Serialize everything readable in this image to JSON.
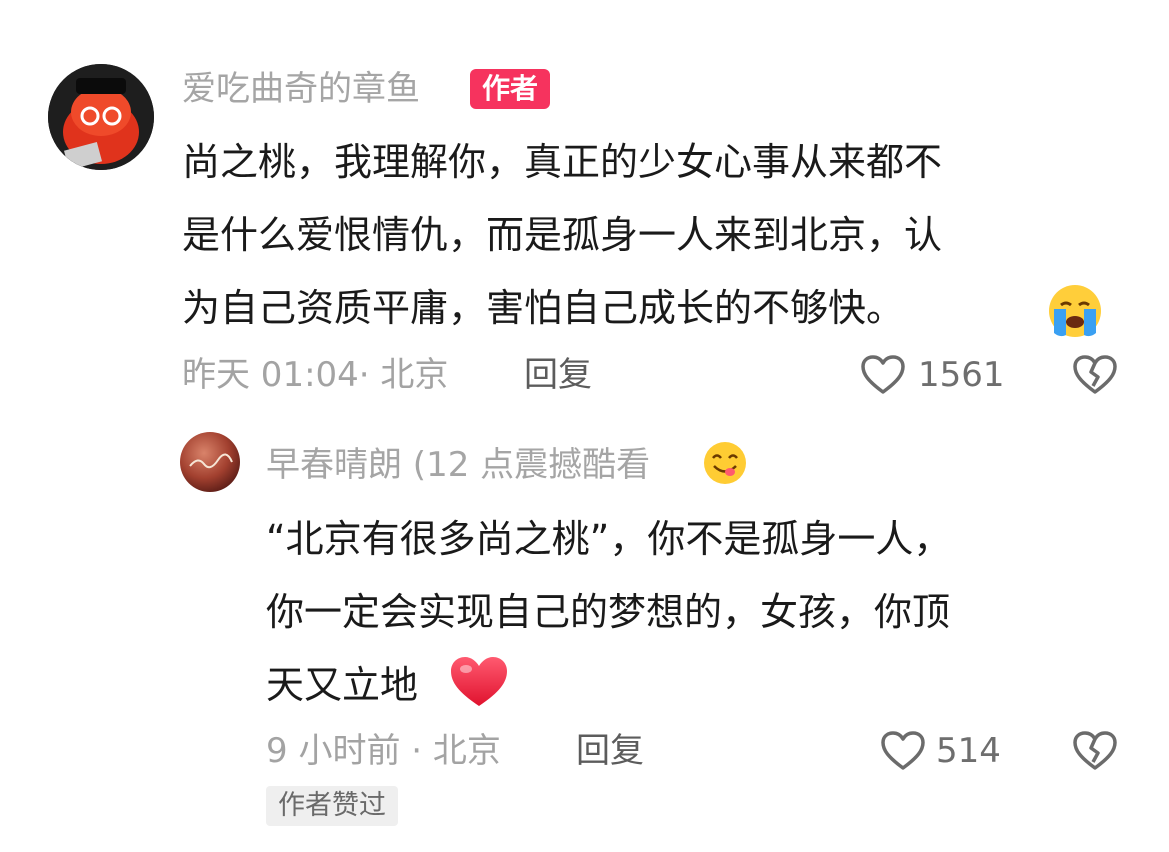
{
  "comment": {
    "username": "爱吃曲奇的章鱼",
    "badge": "作者",
    "lines": [
      "尚之桃，我理解你，真正的少女心事从来都不",
      "是什么爱恨情仇，而是孤身一人来到北京，认",
      "为自己资质平庸，害怕自己成长的不够快。"
    ],
    "emoji_icon": "crying-face-icon",
    "time": "昨天 01:04",
    "location": "· 北京",
    "reply_label": "回复",
    "like_count": "1561"
  },
  "reply": {
    "username": "早春晴朗 (12 点震撼酷看",
    "username_emoji_icon": "yum-face-icon",
    "lines": [
      "“北京有很多尚之桃”，你不是孤身一人，",
      "你一定会实现自己的梦想的，女孩，你顶",
      "天又立地"
    ],
    "emoji_icon": "red-heart-icon",
    "time": "9 小时前",
    "location": "· 北京",
    "reply_label": "回复",
    "like_count": "514",
    "liked_badge": "作者赞过"
  },
  "colors": {
    "author_badge": "#f6335e",
    "meta_text": "#a3a3a3",
    "body_text": "#1a1a1a"
  }
}
